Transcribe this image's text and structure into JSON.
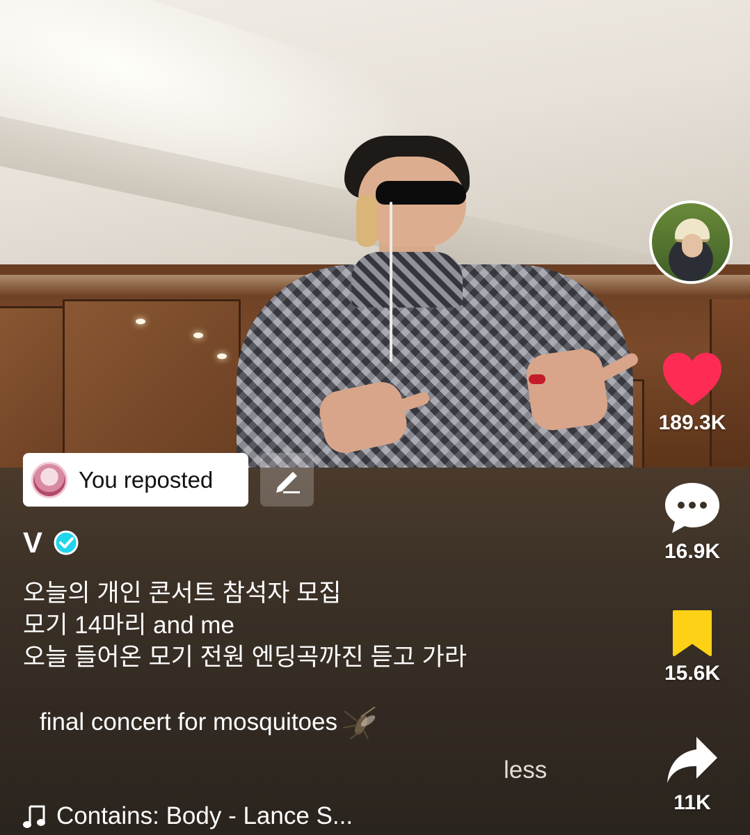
{
  "creator": {
    "name": "V",
    "verified": true
  },
  "repost": {
    "label": "You reposted"
  },
  "caption": {
    "lines": [
      "오늘의 개인 콘서트 참석자 모집",
      "모기 14마리 and me",
      "오늘 들어온 모기 전원 엔딩곡까진 듣고 가라"
    ],
    "translation": "final concert for mosquitoes",
    "less_label": "less"
  },
  "music": {
    "text": "Contains: Body - Lance S..."
  },
  "actions": {
    "likes": "189.3K",
    "comments": "16.9K",
    "saves": "15.6K",
    "shares": "11K"
  },
  "colors": {
    "like": "#fe2c55",
    "save": "#fcd116",
    "verified": "#20d5ec"
  },
  "icons": {
    "like": "heart-icon",
    "comment": "comment-bubble-icon",
    "save": "bookmark-icon",
    "share": "share-arrow-icon",
    "edit": "pencil-icon",
    "music": "music-note-icon",
    "verified": "verified-badge-icon",
    "mosquito": "mosquito-icon"
  }
}
